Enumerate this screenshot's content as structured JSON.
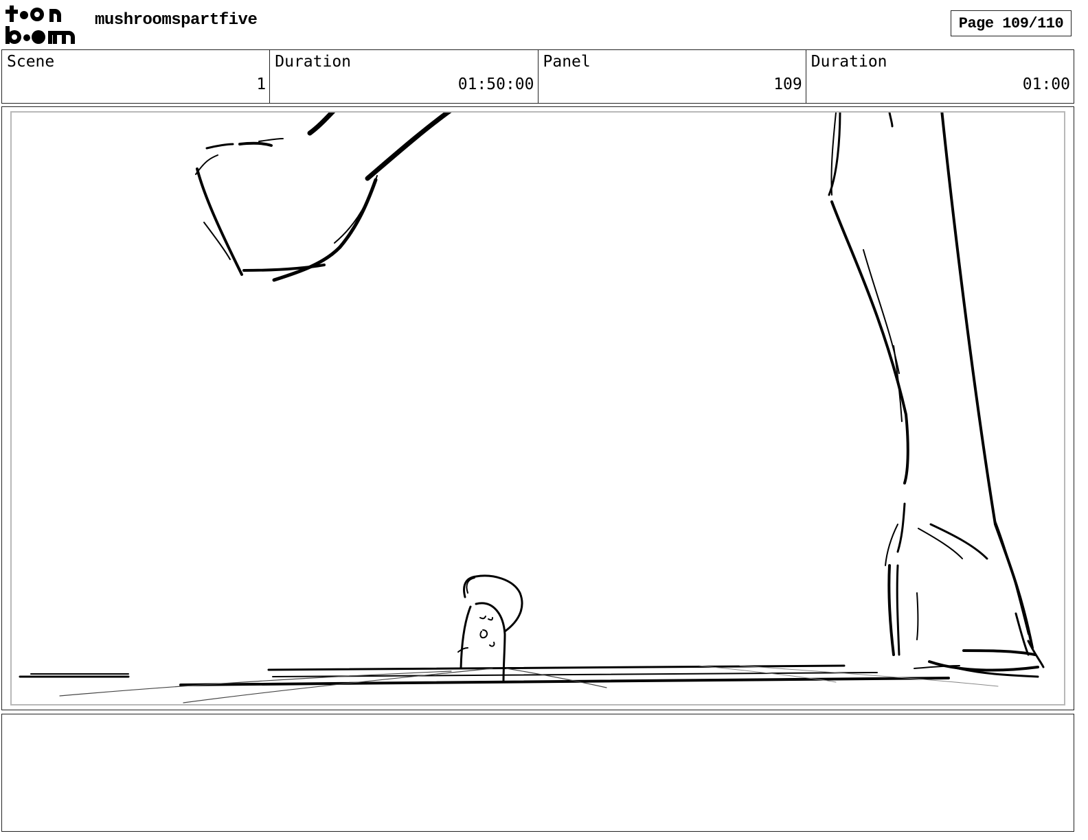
{
  "header": {
    "logo": {
      "line1": "toon",
      "line2": "boom"
    },
    "project_title": "mushroomspartfive",
    "page_label": "Page 109/110"
  },
  "info": {
    "scene_label": "Scene",
    "scene_value": "1",
    "scene_duration_label": "Duration",
    "scene_duration_value": "01:50:00",
    "panel_label": "Panel",
    "panel_value": "109",
    "panel_duration_label": "Duration",
    "panel_duration_value": "01:00"
  },
  "notes": {
    "text": ""
  }
}
